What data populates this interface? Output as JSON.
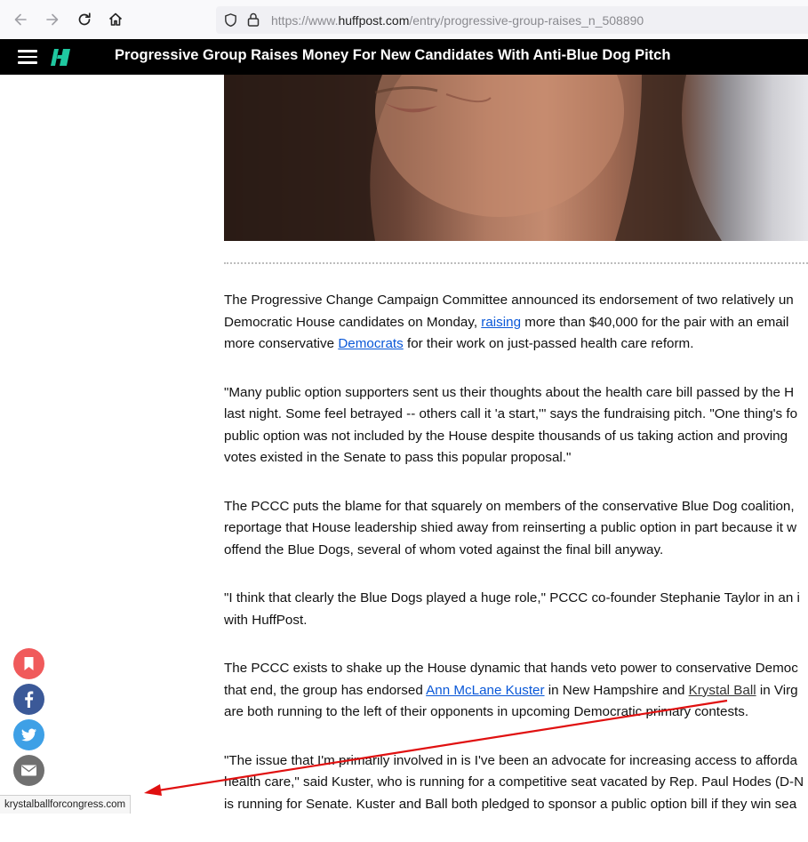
{
  "browser": {
    "url_prefix": "https://www.",
    "url_domain": "huffpost.com",
    "url_path": "/entry/progressive-group-raises_n_508890",
    "status_url": "krystalballforcongress.com"
  },
  "header": {
    "title": "Progressive Group Raises Money For New Candidates With Anti-Blue Dog Pitch"
  },
  "article": {
    "p1": {
      "line1": "The Progressive Change Campaign Committee announced its endorsement of two relatively un",
      "line2_a": "Democratic House candidates on Monday, ",
      "line2_link": "raising",
      "line2_b": " more than $40,000 for the pair with an email",
      "line3_a": "more conservative ",
      "line3_link": "Democrats",
      "line3_b": " for their work on just-passed health care reform."
    },
    "p2": {
      "line1": "\"Many public option supporters sent us their thoughts about the health care bill passed by the H",
      "line2": "last night. Some feel betrayed -- others call it 'a start,'\" says the fundraising pitch. \"One thing's fo",
      "line3": "public option was not included by the House despite thousands of us taking action and proving",
      "line4": "votes existed in the Senate to pass this popular proposal.\""
    },
    "p3": {
      "line1": "The PCCC puts the blame for that squarely on members of the conservative Blue Dog coalition,",
      "line2": "reportage that House leadership shied away from reinserting a public option in part because it w",
      "line3": "offend the Blue Dogs, several of whom voted against the final bill anyway."
    },
    "p4": {
      "line1": "\"I think that clearly the Blue Dogs played a huge role,\" PCCC co-founder Stephanie Taylor in an i",
      "line2": "with HuffPost."
    },
    "p5": {
      "line1": "The PCCC exists to shake up the House dynamic that hands veto power to conservative Democ",
      "line2_a": "that end, the group has endorsed ",
      "line2_link1": "Ann McLane Kuster",
      "line2_b": " in New Hampshire and ",
      "line2_link2": "Krystal Ball",
      "line2_c": " in Virg",
      "line3": "are both running to the left of their opponents in upcoming Democratic primary contests."
    },
    "p6": {
      "line1": "\"The issue that I'm primarily involved in is I've been an advocate for increasing access to afforda",
      "line2": "health care,\" said Kuster, who is running for a competitive seat vacated by Rep. Paul Hodes (D-N",
      "line3": "is running for Senate. Kuster and Ball both pledged to sponsor a public option bill if they win sea"
    }
  },
  "share": {
    "icons": [
      "bookmark-icon",
      "facebook-icon",
      "twitter-icon",
      "email-icon"
    ],
    "colors": {
      "bookmark": "#f05a5b",
      "facebook": "#3b5998",
      "twitter": "#3ea0e6",
      "email": "#707070"
    }
  },
  "annotation": {
    "arrow_color": "#e01010"
  }
}
